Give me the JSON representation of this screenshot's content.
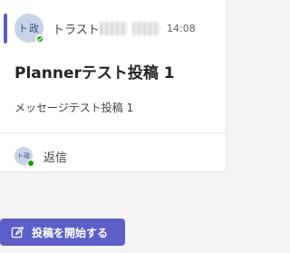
{
  "post": {
    "avatar_initials": "ト政",
    "author": "トラストIT",
    "time": "14:08",
    "title": "Plannerテスト投稿 1",
    "message": "メッセージテスト投稿 1"
  },
  "reply": {
    "avatar_initials": "ト政",
    "label": "返信"
  },
  "actions": {
    "new_post_label": "投稿を開始する",
    "new_post_icon": "compose-icon"
  },
  "colors": {
    "accent": "#5b5fc7",
    "presence_available": "#13a10e"
  }
}
